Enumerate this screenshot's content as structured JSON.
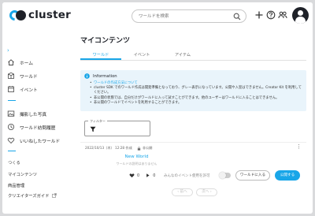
{
  "app": {
    "name": "cluster"
  },
  "header": {
    "search_placeholder": "ワールドを検索"
  },
  "sidebar": {
    "items": [
      {
        "label": "ホーム",
        "icon": "home-icon"
      },
      {
        "label": "ワールド",
        "icon": "world-icon"
      },
      {
        "label": "イベント",
        "icon": "event-icon"
      },
      {
        "label": "撮影した写真",
        "icon": "photo-icon"
      },
      {
        "label": "ワールド訪問履歴",
        "icon": "history-icon"
      },
      {
        "label": "いいねしたワールド",
        "icon": "heart-icon"
      }
    ],
    "section_create": "つくる",
    "links": [
      "マイコンテンツ",
      "商品管理",
      "クリエイターズガイド"
    ]
  },
  "main": {
    "title": "マイコンテンツ",
    "tabs": [
      {
        "label": "ワールド",
        "active": true
      },
      {
        "label": "イベント",
        "active": false
      },
      {
        "label": "アイテム",
        "active": false
      }
    ],
    "info": {
      "heading": "Information",
      "lines": [
        "ワールドの作成方法について",
        "cluster SDK でのワールド作成は開発準備となっており、グレー表示になっています。公開や入室はできません。Creator Kit を利用してください。",
        "非公開の状態では、自分だけがワールドに入って試すことができます。他のユーザーはワールドに入ることはできません。",
        "非公開のワールドでイベントを利用することができます。"
      ]
    },
    "filter_label": "フィルター",
    "world": {
      "date": "2022/10/13（木） 12:28 作成",
      "visibility": "非公開",
      "name": "New World",
      "description": "ワールドの説明はありません",
      "likes": "0",
      "visits": "0",
      "permission_label": "みんなのイベント使用を許可",
      "enter_label": "ワールドに入る",
      "publish_label": "公開する"
    },
    "pager": {
      "prev": "前へ",
      "next": "次へ"
    }
  }
}
